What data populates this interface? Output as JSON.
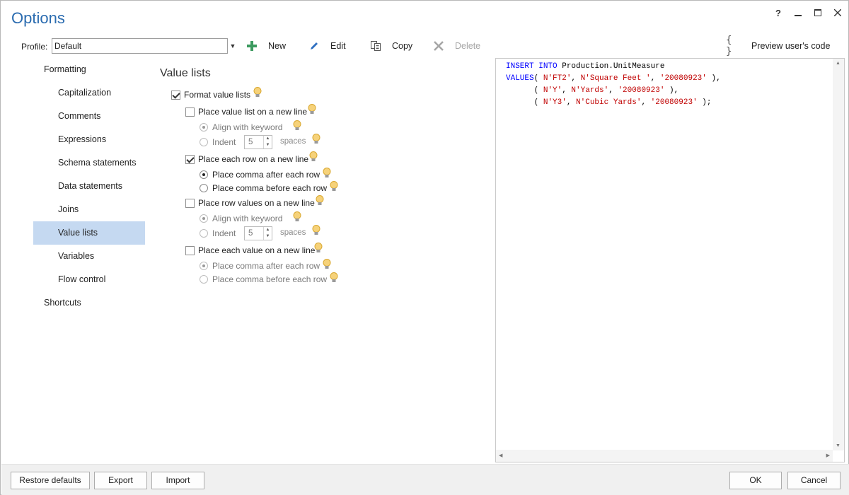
{
  "window": {
    "title": "Options",
    "help_label": "?",
    "minimize_label": "—",
    "maximize_label": "☐",
    "close_label": "✕"
  },
  "toolbar": {
    "profile_label": "Profile:",
    "profile_value": "Default",
    "new_label": "New",
    "edit_label": "Edit",
    "copy_label": "Copy",
    "delete_label": "Delete",
    "preview_label": "Preview user's code",
    "preview_icon_glyph": "{ }"
  },
  "sidebar": {
    "formatting": "Formatting",
    "capitalization": "Capitalization",
    "comments": "Comments",
    "expressions": "Expressions",
    "schema_statements": "Schema statements",
    "data_statements": "Data statements",
    "joins": "Joins",
    "value_lists": "Value lists",
    "variables": "Variables",
    "flow_control": "Flow control",
    "shortcuts": "Shortcuts",
    "selected": "Value lists",
    "selected_color": "#c5d9f1"
  },
  "panel": {
    "title": "Value lists",
    "format_value_lists": {
      "label": "Format value lists",
      "checked": true
    },
    "value_list_new_line": {
      "label": "Place value list on a new line",
      "checked": false
    },
    "vl_align_keyword": {
      "label": "Align with keyword",
      "checked": true,
      "enabled": false
    },
    "vl_indent": {
      "label": "Indent",
      "value": "5",
      "unit": "spaces",
      "enabled": false
    },
    "each_row_new_line": {
      "label": "Place each row on a new line",
      "checked": true
    },
    "row_comma_after": {
      "label": "Place comma after each row",
      "checked": true
    },
    "row_comma_before": {
      "label": "Place comma before each row",
      "checked": false
    },
    "row_values_new_line": {
      "label": "Place row values on a new line",
      "checked": false
    },
    "rv_align_keyword": {
      "label": "Align with keyword",
      "checked": true,
      "enabled": false
    },
    "rv_indent": {
      "label": "Indent",
      "value": "5",
      "unit": "spaces",
      "enabled": false
    },
    "each_value_new_line": {
      "label": "Place each value on a new line",
      "checked": false
    },
    "val_comma_after": {
      "label": "Place comma after each row",
      "checked": true,
      "enabled": false
    },
    "val_comma_before": {
      "label": "Place comma before each row",
      "checked": false,
      "enabled": false
    }
  },
  "preview": {
    "line1_kw1": "INSERT",
    "line1_kw2": "INTO",
    "line1_obj": "Production.UnitMeasure",
    "line2_kw": "VALUES",
    "line2_open": "( ",
    "line2_v1": "N'FT2'",
    "line2_v2": "N'Square Feet '",
    "line2_v3": "'20080923'",
    "line2_close": " ),",
    "line3_v1": "N'Y'",
    "line3_v2": "N'Yards'",
    "line3_v3": "'20080923'",
    "line3_close": " ),",
    "line4_v1": "N'Y3'",
    "line4_v2": "N'Cubic Yards'",
    "line4_v3": "'20080923'",
    "line4_close": " );",
    "keyword_color": "#0000ff",
    "string_color": "#c00000"
  },
  "footer": {
    "restore_label": "Restore defaults",
    "export_label": "Export",
    "import_label": "Import",
    "ok_label": "OK",
    "cancel_label": "Cancel"
  }
}
